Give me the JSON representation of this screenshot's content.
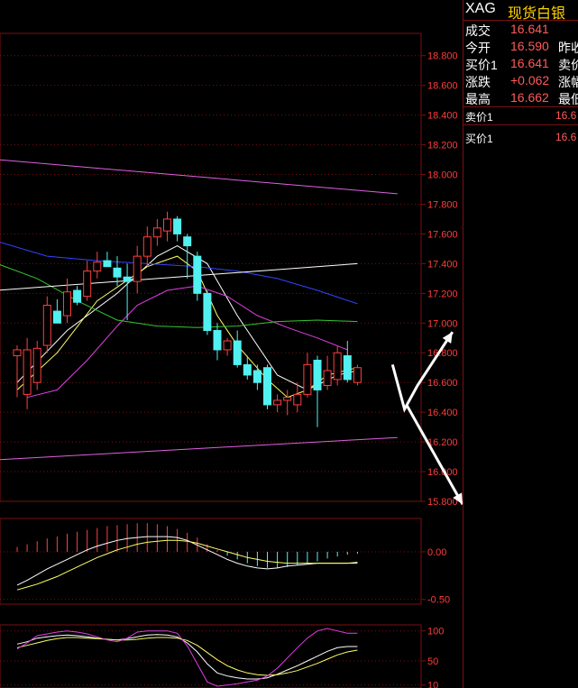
{
  "colors": {
    "background": "#000000",
    "grid": "#7a1010",
    "axis_text": "#ff3b3b",
    "bull_candle": "#ff4040",
    "bear_candle": "#52f0f0",
    "ma_white": "#ffffff",
    "ma_yellow": "#ffff66",
    "ma_magenta": "#e040e0",
    "ma_green": "#33c633",
    "ma_blue": "#3344ff",
    "channel_line": "#e060e0",
    "arrow": "#ffffff"
  },
  "quote_panel": {
    "symbol": "XAG",
    "name": "现货白银",
    "rows": [
      {
        "label": "成交",
        "value": "16.641",
        "right_label": ""
      },
      {
        "label": "今开",
        "value": "16.590",
        "right_label": "昨收"
      },
      {
        "label": "买价1",
        "value": "16.641",
        "right_label": "卖价"
      },
      {
        "label": "涨跌",
        "value": "+0.062",
        "right_label": "涨幅"
      },
      {
        "label": "最高",
        "value": "16.662",
        "right_label": "最低"
      }
    ],
    "book": [
      {
        "label": "卖价1",
        "value": "16.6"
      },
      {
        "label": "买价1",
        "value": "16.6"
      }
    ]
  },
  "chart_data": [
    {
      "type": "candlestick",
      "panel": "main",
      "ylim": [
        15.8,
        18.95
      ],
      "y_ticks": [
        "18.800",
        "18.600",
        "18.400",
        "18.200",
        "18.000",
        "17.800",
        "17.600",
        "17.400",
        "17.200",
        "17.000",
        "16.800",
        "16.600",
        "16.400",
        "16.200",
        "16.000",
        "15.800"
      ],
      "candles": [
        {
          "o": 16.78,
          "h": 16.85,
          "l": 16.5,
          "c": 16.82
        },
        {
          "o": 16.52,
          "h": 16.9,
          "l": 16.42,
          "c": 16.82
        },
        {
          "o": 16.6,
          "h": 16.88,
          "l": 16.55,
          "c": 16.83
        },
        {
          "o": 16.85,
          "h": 17.18,
          "l": 16.8,
          "c": 17.12
        },
        {
          "o": 17.08,
          "h": 17.16,
          "l": 17.0,
          "c": 17.0
        },
        {
          "o": 17.05,
          "h": 17.3,
          "l": 17.0,
          "c": 17.21
        },
        {
          "o": 17.22,
          "h": 17.25,
          "l": 17.12,
          "c": 17.14
        },
        {
          "o": 17.18,
          "h": 17.42,
          "l": 17.15,
          "c": 17.35
        },
        {
          "o": 17.35,
          "h": 17.48,
          "l": 17.3,
          "c": 17.41
        },
        {
          "o": 17.42,
          "h": 17.48,
          "l": 17.38,
          "c": 17.38
        },
        {
          "o": 17.37,
          "h": 17.45,
          "l": 17.25,
          "c": 17.31
        },
        {
          "o": 17.31,
          "h": 17.4,
          "l": 17.02,
          "c": 17.28
        },
        {
          "o": 17.28,
          "h": 17.52,
          "l": 17.2,
          "c": 17.45
        },
        {
          "o": 17.45,
          "h": 17.65,
          "l": 17.38,
          "c": 17.58
        },
        {
          "o": 17.58,
          "h": 17.7,
          "l": 17.52,
          "c": 17.64
        },
        {
          "o": 17.62,
          "h": 17.75,
          "l": 17.55,
          "c": 17.7
        },
        {
          "o": 17.7,
          "h": 17.72,
          "l": 17.55,
          "c": 17.6
        },
        {
          "o": 17.58,
          "h": 17.6,
          "l": 17.3,
          "c": 17.52
        },
        {
          "o": 17.45,
          "h": 17.48,
          "l": 17.15,
          "c": 17.2
        },
        {
          "o": 17.2,
          "h": 17.22,
          "l": 16.92,
          "c": 16.95
        },
        {
          "o": 16.95,
          "h": 17.0,
          "l": 16.75,
          "c": 16.82
        },
        {
          "o": 16.82,
          "h": 16.9,
          "l": 16.78,
          "c": 16.88
        },
        {
          "o": 16.88,
          "h": 16.95,
          "l": 16.7,
          "c": 16.72
        },
        {
          "o": 16.72,
          "h": 16.78,
          "l": 16.62,
          "c": 16.65
        },
        {
          "o": 16.68,
          "h": 16.72,
          "l": 16.55,
          "c": 16.6
        },
        {
          "o": 16.7,
          "h": 16.72,
          "l": 16.42,
          "c": 16.45
        },
        {
          "o": 16.45,
          "h": 16.52,
          "l": 16.4,
          "c": 16.48
        },
        {
          "o": 16.48,
          "h": 16.55,
          "l": 16.38,
          "c": 16.5
        },
        {
          "o": 16.45,
          "h": 16.6,
          "l": 16.4,
          "c": 16.52
        },
        {
          "o": 16.52,
          "h": 16.8,
          "l": 16.5,
          "c": 16.72
        },
        {
          "o": 16.75,
          "h": 16.78,
          "l": 16.3,
          "c": 16.55
        },
        {
          "o": 16.58,
          "h": 16.78,
          "l": 16.55,
          "c": 16.68
        },
        {
          "o": 16.62,
          "h": 16.85,
          "l": 16.58,
          "c": 16.8
        },
        {
          "o": 16.78,
          "h": 16.88,
          "l": 16.6,
          "c": 16.62
        },
        {
          "o": 16.6,
          "h": 16.72,
          "l": 16.58,
          "c": 16.7
        }
      ],
      "lines": [
        {
          "key": "ma_white",
          "points": [
            [
              0,
              16.6
            ],
            [
              5,
              16.95
            ],
            [
              10,
              17.2
            ],
            [
              14,
              17.45
            ],
            [
              16,
              17.52
            ],
            [
              19,
              17.4
            ],
            [
              22,
              17.05
            ],
            [
              26,
              16.65
            ],
            [
              29,
              16.55
            ],
            [
              32,
              16.65
            ],
            [
              34,
              16.68
            ]
          ]
        },
        {
          "key": "ma_yellow",
          "points": [
            [
              0,
              16.55
            ],
            [
              4,
              16.8
            ],
            [
              8,
              17.15
            ],
            [
              13,
              17.38
            ],
            [
              16,
              17.45
            ],
            [
              18,
              17.35
            ],
            [
              20,
              17.05
            ],
            [
              22,
              16.85
            ],
            [
              25,
              16.62
            ],
            [
              27,
              16.5
            ],
            [
              29,
              16.55
            ],
            [
              31,
              16.65
            ],
            [
              34,
              16.7
            ]
          ]
        },
        {
          "key": "ma_magenta",
          "points": [
            [
              1,
              16.5
            ],
            [
              4,
              16.55
            ],
            [
              7,
              16.75
            ],
            [
              10,
              16.98
            ],
            [
              12,
              17.12
            ],
            [
              15,
              17.22
            ],
            [
              18,
              17.25
            ],
            [
              21,
              17.18
            ],
            [
              24,
              17.05
            ],
            [
              27,
              16.97
            ],
            [
              30,
              16.9
            ],
            [
              33,
              16.82
            ]
          ]
        },
        {
          "key": "ma_green",
          "points": [
            [
              -2,
              17.4
            ],
            [
              2,
              17.3
            ],
            [
              6,
              17.15
            ],
            [
              10,
              17.02
            ],
            [
              14,
              16.98
            ],
            [
              18,
              16.97
            ],
            [
              22,
              16.98
            ],
            [
              26,
              17.01
            ],
            [
              30,
              17.02
            ],
            [
              34,
              17.01
            ]
          ]
        },
        {
          "key": "ma_blue",
          "points": [
            [
              -2,
              17.55
            ],
            [
              3,
              17.45
            ],
            [
              8,
              17.42
            ],
            [
              13,
              17.4
            ],
            [
              18,
              17.38
            ],
            [
              22,
              17.35
            ],
            [
              26,
              17.3
            ],
            [
              30,
              17.22
            ],
            [
              34,
              17.13
            ]
          ]
        },
        {
          "key": "ma_white",
          "points": [
            [
              -2,
              17.22
            ],
            [
              34,
              17.4
            ]
          ]
        },
        {
          "key": "channel_line",
          "points": [
            [
              -2,
              18.1
            ],
            [
              38,
              17.87
            ]
          ]
        },
        {
          "key": "channel_line",
          "points": [
            [
              -2,
              16.08
            ],
            [
              38,
              16.23
            ]
          ]
        }
      ],
      "annotations": [
        {
          "type": "arrow",
          "points": [
            [
              37.5,
              16.72
            ],
            [
              38.7,
              16.42
            ],
            [
              40,
              16.58
            ],
            [
              43.5,
              16.94
            ]
          ]
        },
        {
          "type": "arrow",
          "points": [
            [
              38.9,
              16.45
            ],
            [
              44.5,
              15.78
            ]
          ]
        }
      ]
    },
    {
      "type": "bar",
      "panel": "macd",
      "ylim": [
        -0.55,
        0.35
      ],
      "y_ticks": [
        "0.00",
        "-0.50"
      ],
      "values": [
        0.05,
        0.08,
        0.11,
        0.14,
        0.16,
        0.19,
        0.21,
        0.23,
        0.25,
        0.27,
        0.28,
        0.29,
        0.3,
        0.3,
        0.29,
        0.27,
        0.24,
        0.2,
        0.15,
        0.08,
        0.02,
        -0.04,
        -0.08,
        -0.12,
        -0.15,
        -0.17,
        -0.17,
        -0.16,
        -0.14,
        -0.12,
        -0.1,
        -0.07,
        -0.05,
        -0.03,
        -0.02
      ],
      "dif": [
        -0.35,
        -0.3,
        -0.24,
        -0.18,
        -0.13,
        -0.08,
        -0.03,
        0.02,
        0.06,
        0.09,
        0.12,
        0.14,
        0.15,
        0.16,
        0.16,
        0.16,
        0.15,
        0.12,
        0.07,
        0.02,
        -0.03,
        -0.08,
        -0.12,
        -0.15,
        -0.17,
        -0.18,
        -0.17,
        -0.15,
        -0.14,
        -0.13,
        -0.12,
        -0.12,
        -0.12,
        -0.12,
        -0.11
      ],
      "dea": [
        -0.4,
        -0.37,
        -0.34,
        -0.3,
        -0.26,
        -0.21,
        -0.16,
        -0.11,
        -0.06,
        -0.02,
        0.02,
        0.05,
        0.08,
        0.1,
        0.11,
        0.12,
        0.12,
        0.11,
        0.09,
        0.06,
        0.03,
        0.0,
        -0.03,
        -0.06,
        -0.08,
        -0.1,
        -0.11,
        -0.12,
        -0.12,
        -0.12,
        -0.12,
        -0.12,
        -0.12,
        -0.12,
        -0.12
      ]
    },
    {
      "type": "line",
      "panel": "kdj",
      "ylim": [
        5,
        110
      ],
      "y_ticks": [
        "100",
        "50",
        "10"
      ],
      "k": [
        78,
        82,
        88,
        90,
        92,
        93,
        92,
        90,
        88,
        86,
        85,
        87,
        90,
        93,
        94,
        93,
        90,
        80,
        65,
        45,
        30,
        25,
        22,
        20,
        20,
        22,
        28,
        35,
        42,
        50,
        58,
        66,
        72,
        74,
        74
      ],
      "d": [
        72,
        76,
        80,
        84,
        87,
        89,
        89,
        88,
        87,
        86,
        85,
        85,
        86,
        88,
        89,
        89,
        88,
        84,
        76,
        64,
        52,
        42,
        35,
        30,
        27,
        26,
        27,
        30,
        34,
        40,
        46,
        53,
        60,
        65,
        68
      ],
      "j": [
        70,
        80,
        92,
        95,
        98,
        100,
        98,
        95,
        90,
        85,
        82,
        88,
        98,
        100,
        100,
        100,
        96,
        75,
        45,
        15,
        8,
        10,
        12,
        15,
        18,
        25,
        38,
        55,
        72,
        88,
        100,
        104,
        100,
        96,
        96
      ]
    }
  ]
}
